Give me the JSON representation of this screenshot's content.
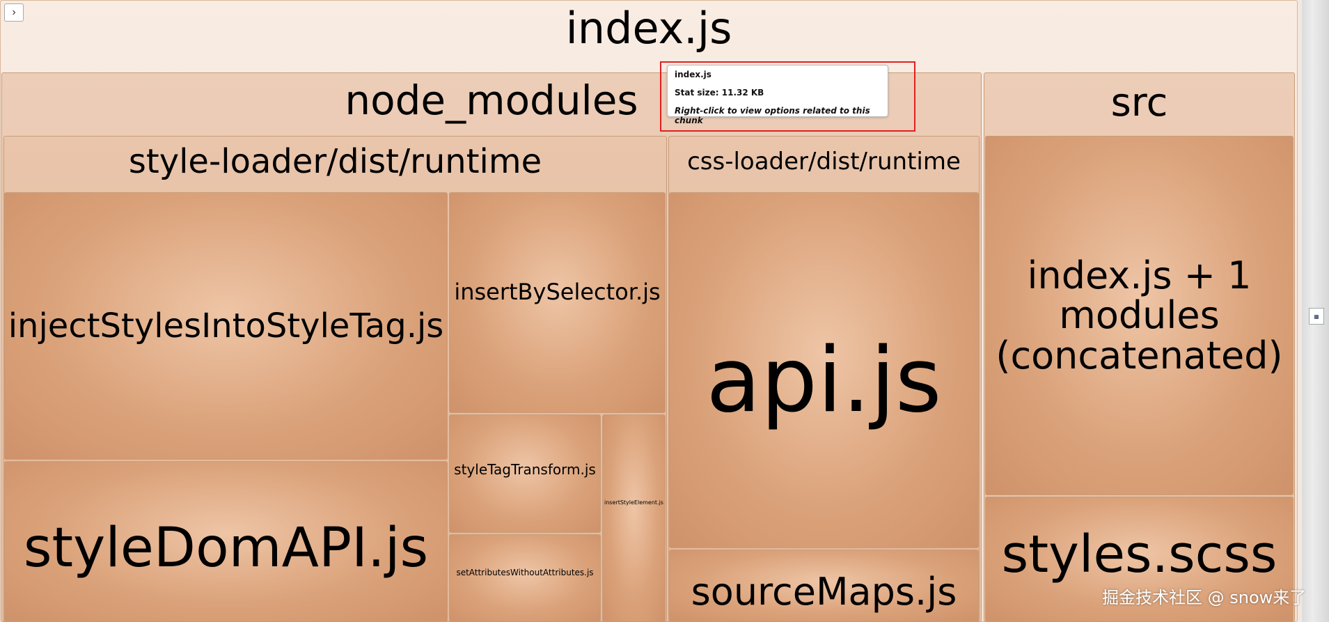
{
  "toggle_glyph": "›",
  "root": {
    "label": "index.js"
  },
  "node_modules": {
    "label": "node_modules"
  },
  "style_loader": {
    "label": "style-loader/dist/runtime"
  },
  "css_loader": {
    "label": "css-loader/dist/runtime"
  },
  "src": {
    "label": "src"
  },
  "modules": {
    "injectStylesIntoStyleTag": "injectStylesIntoStyleTag.js",
    "insertBySelector": "insertBySelector.js",
    "styleDomAPI": "styleDomAPI.js",
    "styleTagTransform": "styleTagTransform.js",
    "setAttributesWithoutAttributes": "setAttributesWithoutAttributes.js",
    "insertStyleElement": "insertStyleElement.js",
    "api": "api.js",
    "sourceMaps": "sourceMaps.js",
    "indexConcatenated": "index.js + 1 modules (concatenated)",
    "styles": "styles.scss"
  },
  "tooltip": {
    "name": "index.js",
    "stat_size": "Stat size: 11.32 KB",
    "hint": "Right-click to view options related to this chunk"
  },
  "watermark": "掘金技术社区 @ snow来了",
  "colors": {
    "leaf": "#dba37b",
    "highlight": "#e02020"
  }
}
